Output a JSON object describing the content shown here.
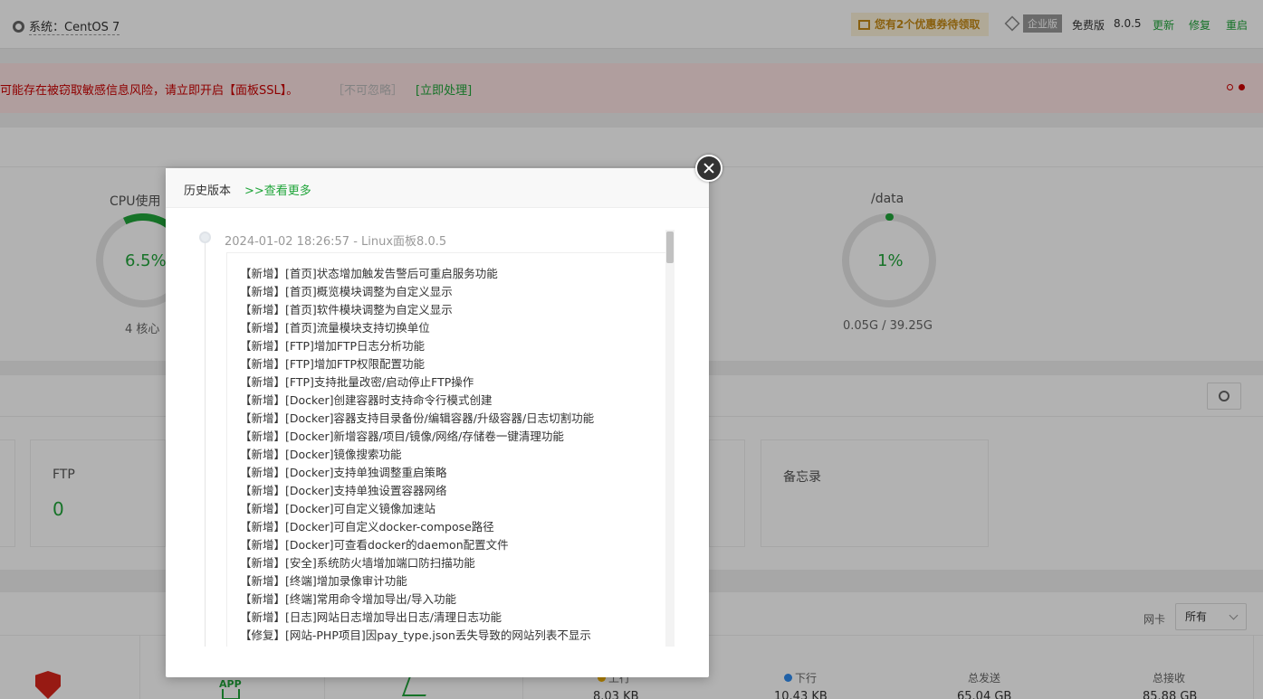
{
  "topbar": {
    "system": "系统：CentOS 7",
    "coupon": "您有2个优惠券待领取",
    "enterprise": "企业版",
    "free": "免费版",
    "version": "8.0.5",
    "update": "更新",
    "repair": "修复",
    "restart": "重启"
  },
  "alert": {
    "text": "可能存在被窃取敏感信息风险，请立即开启【面板SSL】。",
    "ignore": "［不可忽略］",
    "handle": "[立即处理]"
  },
  "gauges": {
    "cpu": {
      "title": "CPU使用",
      "value": "6.5%",
      "sub": "4 核心"
    },
    "data": {
      "title": "/data",
      "value": "1%",
      "sub": "0.05G / 39.25G"
    }
  },
  "cards": {
    "ftp": {
      "title": "FTP",
      "value": "0"
    },
    "memo": {
      "title": "备忘录"
    }
  },
  "network": {
    "nic_label": "网卡",
    "nic_value": "所有",
    "upload": {
      "label": "上行",
      "value": "8.03 KB",
      "color": "#f7b500"
    },
    "download": {
      "label": "下行",
      "value": "10.43 KB",
      "color": "#2f8cf0"
    },
    "total_sent": {
      "label": "总发送",
      "value": "65.04 GB"
    },
    "total_recv": {
      "label": "总接收",
      "value": "85.88 GB"
    }
  },
  "icons": {
    "app": "APP"
  },
  "modal": {
    "title": "历史版本",
    "more": ">>查看更多",
    "entry_header": "2024-01-02 18:26:57 - Linux面板8.0.5",
    "changes": [
      "【新增】[首页]状态增加触发告警后可重启服务功能",
      "【新增】[首页]概览模块调整为自定义显示",
      "【新增】[首页]软件模块调整为自定义显示",
      "【新增】[首页]流量模块支持切换单位",
      "【新增】[FTP]增加FTP日志分析功能",
      "【新增】[FTP]增加FTP权限配置功能",
      "【新增】[FTP]支持批量改密/启动停止FTP操作",
      "【新增】[Docker]创建容器时支持命令行模式创建",
      "【新增】[Docker]容器支持目录备份/编辑容器/升级容器/日志切割功能",
      "【新增】[Docker]新增容器/项目/镜像/网络/存储卷一键清理功能",
      "【新增】[Docker]镜像搜索功能",
      "【新增】[Docker]支持单独调整重启策略",
      "【新增】[Docker]支持单独设置容器网络",
      "【新增】[Docker]可自定义镜像加速站",
      "【新增】[Docker]可自定义docker-compose路径",
      "【新增】[Docker]可查看docker的daemon配置文件",
      "【新增】[安全]系统防火墙增加端口防扫描功能",
      "【新增】[终端]增加录像审计功能",
      "【新增】[终端]常用命令增加导出/导入功能",
      "【新增】[日志]网站日志增加导出日志/清理日志功能",
      "【修复】[网站-PHP项目]因pay_type.json丢失导致的网站列表不显示"
    ]
  }
}
